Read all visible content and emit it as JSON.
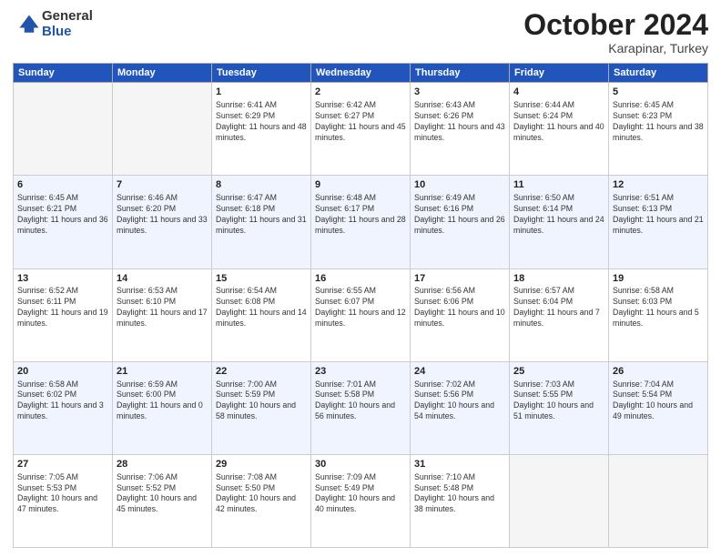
{
  "logo": {
    "general": "General",
    "blue": "Blue"
  },
  "title": "October 2024",
  "location": "Karapinar, Turkey",
  "days_header": [
    "Sunday",
    "Monday",
    "Tuesday",
    "Wednesday",
    "Thursday",
    "Friday",
    "Saturday"
  ],
  "weeks": [
    [
      {
        "day": "",
        "info": "",
        "empty": true
      },
      {
        "day": "",
        "info": "",
        "empty": true
      },
      {
        "day": "1",
        "info": "Sunrise: 6:41 AM\nSunset: 6:29 PM\nDaylight: 11 hours and 48 minutes."
      },
      {
        "day": "2",
        "info": "Sunrise: 6:42 AM\nSunset: 6:27 PM\nDaylight: 11 hours and 45 minutes."
      },
      {
        "day": "3",
        "info": "Sunrise: 6:43 AM\nSunset: 6:26 PM\nDaylight: 11 hours and 43 minutes."
      },
      {
        "day": "4",
        "info": "Sunrise: 6:44 AM\nSunset: 6:24 PM\nDaylight: 11 hours and 40 minutes."
      },
      {
        "day": "5",
        "info": "Sunrise: 6:45 AM\nSunset: 6:23 PM\nDaylight: 11 hours and 38 minutes."
      }
    ],
    [
      {
        "day": "6",
        "info": "Sunrise: 6:45 AM\nSunset: 6:21 PM\nDaylight: 11 hours and 36 minutes."
      },
      {
        "day": "7",
        "info": "Sunrise: 6:46 AM\nSunset: 6:20 PM\nDaylight: 11 hours and 33 minutes."
      },
      {
        "day": "8",
        "info": "Sunrise: 6:47 AM\nSunset: 6:18 PM\nDaylight: 11 hours and 31 minutes."
      },
      {
        "day": "9",
        "info": "Sunrise: 6:48 AM\nSunset: 6:17 PM\nDaylight: 11 hours and 28 minutes."
      },
      {
        "day": "10",
        "info": "Sunrise: 6:49 AM\nSunset: 6:16 PM\nDaylight: 11 hours and 26 minutes."
      },
      {
        "day": "11",
        "info": "Sunrise: 6:50 AM\nSunset: 6:14 PM\nDaylight: 11 hours and 24 minutes."
      },
      {
        "day": "12",
        "info": "Sunrise: 6:51 AM\nSunset: 6:13 PM\nDaylight: 11 hours and 21 minutes."
      }
    ],
    [
      {
        "day": "13",
        "info": "Sunrise: 6:52 AM\nSunset: 6:11 PM\nDaylight: 11 hours and 19 minutes."
      },
      {
        "day": "14",
        "info": "Sunrise: 6:53 AM\nSunset: 6:10 PM\nDaylight: 11 hours and 17 minutes."
      },
      {
        "day": "15",
        "info": "Sunrise: 6:54 AM\nSunset: 6:08 PM\nDaylight: 11 hours and 14 minutes."
      },
      {
        "day": "16",
        "info": "Sunrise: 6:55 AM\nSunset: 6:07 PM\nDaylight: 11 hours and 12 minutes."
      },
      {
        "day": "17",
        "info": "Sunrise: 6:56 AM\nSunset: 6:06 PM\nDaylight: 11 hours and 10 minutes."
      },
      {
        "day": "18",
        "info": "Sunrise: 6:57 AM\nSunset: 6:04 PM\nDaylight: 11 hours and 7 minutes."
      },
      {
        "day": "19",
        "info": "Sunrise: 6:58 AM\nSunset: 6:03 PM\nDaylight: 11 hours and 5 minutes."
      }
    ],
    [
      {
        "day": "20",
        "info": "Sunrise: 6:58 AM\nSunset: 6:02 PM\nDaylight: 11 hours and 3 minutes."
      },
      {
        "day": "21",
        "info": "Sunrise: 6:59 AM\nSunset: 6:00 PM\nDaylight: 11 hours and 0 minutes."
      },
      {
        "day": "22",
        "info": "Sunrise: 7:00 AM\nSunset: 5:59 PM\nDaylight: 10 hours and 58 minutes."
      },
      {
        "day": "23",
        "info": "Sunrise: 7:01 AM\nSunset: 5:58 PM\nDaylight: 10 hours and 56 minutes."
      },
      {
        "day": "24",
        "info": "Sunrise: 7:02 AM\nSunset: 5:56 PM\nDaylight: 10 hours and 54 minutes."
      },
      {
        "day": "25",
        "info": "Sunrise: 7:03 AM\nSunset: 5:55 PM\nDaylight: 10 hours and 51 minutes."
      },
      {
        "day": "26",
        "info": "Sunrise: 7:04 AM\nSunset: 5:54 PM\nDaylight: 10 hours and 49 minutes."
      }
    ],
    [
      {
        "day": "27",
        "info": "Sunrise: 7:05 AM\nSunset: 5:53 PM\nDaylight: 10 hours and 47 minutes."
      },
      {
        "day": "28",
        "info": "Sunrise: 7:06 AM\nSunset: 5:52 PM\nDaylight: 10 hours and 45 minutes."
      },
      {
        "day": "29",
        "info": "Sunrise: 7:08 AM\nSunset: 5:50 PM\nDaylight: 10 hours and 42 minutes."
      },
      {
        "day": "30",
        "info": "Sunrise: 7:09 AM\nSunset: 5:49 PM\nDaylight: 10 hours and 40 minutes."
      },
      {
        "day": "31",
        "info": "Sunrise: 7:10 AM\nSunset: 5:48 PM\nDaylight: 10 hours and 38 minutes."
      },
      {
        "day": "",
        "info": "",
        "empty": true
      },
      {
        "day": "",
        "info": "",
        "empty": true
      }
    ]
  ]
}
